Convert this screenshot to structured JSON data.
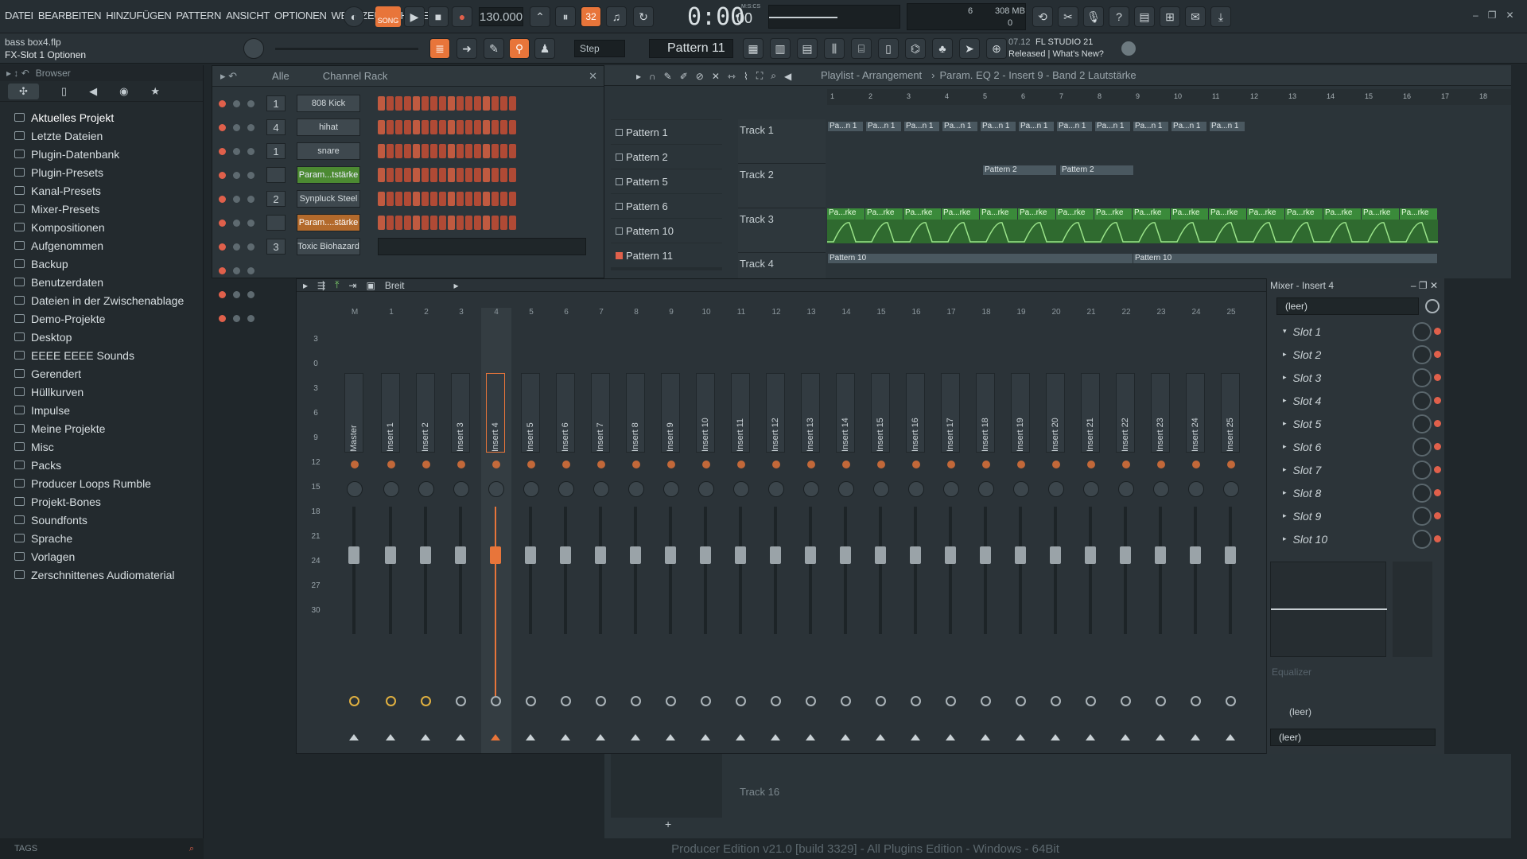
{
  "menu": [
    "DATEI",
    "BEARBEITEN",
    "HINZUFÜGEN",
    "PATTERN",
    "ANSICHT",
    "OPTIONEN",
    "WERKZEUGE",
    "HILFE"
  ],
  "transport": {
    "song_pat": "SONG",
    "tempo": "130.000",
    "time": "0:00",
    "time_small": "00",
    "time_unit": "M:S:CS",
    "step_count": "32",
    "cpu": "6",
    "mem": "308 MB",
    "poly": "0"
  },
  "info": {
    "file": "bass box4.flp",
    "hint": "FX-Slot 1 Optionen",
    "snap": "Step",
    "pattern": "Pattern 11",
    "news_date": "07.12",
    "news_title": "FL STUDIO 21",
    "news_line": "Released | What's New?"
  },
  "browser": {
    "title": "Browser",
    "items": [
      "Aktuelles Projekt",
      "Letzte Dateien",
      "Plugin-Datenbank",
      "Plugin-Presets",
      "Kanal-Presets",
      "Mixer-Presets",
      "Kompositionen",
      "Aufgenommen",
      "Backup",
      "Benutzerdaten",
      "Dateien in der Zwischenablage",
      "Demo-Projekte",
      "Desktop",
      "EEEE EEEE Sounds",
      "Gerendert",
      "Hüllkurven",
      "Impulse",
      "Meine Projekte",
      "Misc",
      "Packs",
      "Producer Loops Rumble",
      "Projekt-Bones",
      "Soundfonts",
      "Sprache",
      "Vorlagen",
      "Zerschnittenes Audiomaterial"
    ],
    "tags": "TAGS"
  },
  "channel_rack": {
    "filter": "Alle",
    "title": "Channel Rack",
    "channels": [
      {
        "num": "1",
        "name": "808 Kick",
        "style": "n"
      },
      {
        "num": "4",
        "name": "hihat",
        "style": "n"
      },
      {
        "num": "1",
        "name": "snare",
        "style": "n"
      },
      {
        "num": "",
        "name": "Param...tstärke",
        "style": "g"
      },
      {
        "num": "2",
        "name": "Synpluck Steel",
        "style": "n"
      },
      {
        "num": "",
        "name": "Param....stärke",
        "style": "o"
      },
      {
        "num": "3",
        "name": "Toxic Biohazard",
        "style": "n"
      }
    ]
  },
  "patterns": [
    "Pattern 1",
    "Pattern 2",
    "Pattern 5",
    "Pattern 6",
    "Pattern 10",
    "Pattern 11"
  ],
  "playlist": {
    "title": "Playlist - Arrangement",
    "crumb": "Param. EQ 2 - Insert 9 - Band 2 Lautstärke",
    "tracks": [
      "Track 1",
      "Track 2",
      "Track 3",
      "Track 4",
      "Track 16"
    ],
    "clip1": "Pa...n 1",
    "clip2": "Pattern 2",
    "clip3": "Pa...rke",
    "clip4": "Pattern 10",
    "ruler": [
      "1",
      "2",
      "3",
      "4",
      "5",
      "6",
      "7",
      "8",
      "9",
      "10",
      "11",
      "12",
      "13",
      "14",
      "15",
      "16",
      "17",
      "18"
    ]
  },
  "mixer": {
    "mode": "Breit",
    "title": "Mixer - Insert 4",
    "scale": [
      "3",
      "0",
      "3",
      "6",
      "9",
      "12",
      "15",
      "18",
      "21",
      "24",
      "27",
      "30"
    ],
    "strips": [
      "Master",
      "Insert 1",
      "Insert 2",
      "Insert 3",
      "Insert 4",
      "Insert 5",
      "Insert 6",
      "Insert 7",
      "Insert 8",
      "Insert 9",
      "Insert 10",
      "Insert 11",
      "Insert 12",
      "Insert 13",
      "Insert 14",
      "Insert 15",
      "Insert 16",
      "Insert 17",
      "Insert 18",
      "Insert 19",
      "Insert 20",
      "Insert 21",
      "Insert 22",
      "Insert 23",
      "Insert 24",
      "Insert 25"
    ],
    "nums": [
      "M",
      "1",
      "2",
      "3",
      "4",
      "5",
      "6",
      "7",
      "8",
      "9",
      "10",
      "11",
      "12",
      "13",
      "14",
      "15",
      "16",
      "17",
      "18",
      "19",
      "20",
      "21",
      "22",
      "23",
      "24",
      "25"
    ],
    "preset": "(leer)",
    "slots": [
      "Slot 1",
      "Slot 2",
      "Slot 3",
      "Slot 4",
      "Slot 5",
      "Slot 6",
      "Slot 7",
      "Slot 8",
      "Slot 9",
      "Slot 10"
    ],
    "eq_label": "Equalizer",
    "out1": "(leer)",
    "out2": "(leer)"
  },
  "status": "Producer Edition v21.0 [build 3329] - All Plugins Edition - Windows - 64Bit",
  "colors": {
    "accent": "#e8753a",
    "green": "#4c8a32",
    "step": "#b04a35"
  }
}
